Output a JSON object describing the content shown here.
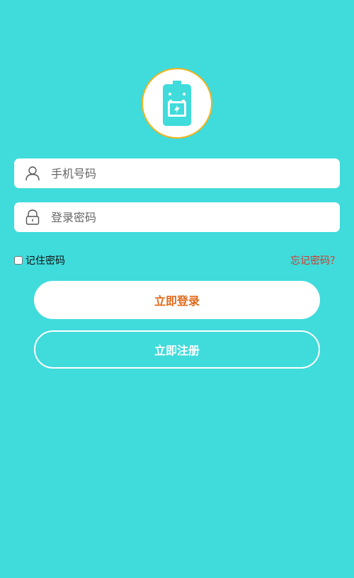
{
  "form": {
    "phone_placeholder": "手机号码",
    "password_placeholder": "登录密码"
  },
  "options": {
    "remember_label": "记住密码",
    "forgot_label": "忘记密码？"
  },
  "buttons": {
    "login_label": "立即登录",
    "register_label": "立即注册"
  },
  "icons": {
    "logo": "battery-icon",
    "phone": "user-icon",
    "password": "lock-icon"
  },
  "colors": {
    "background": "#40DBDB",
    "logo_border": "#F2B31C",
    "login_text": "#E06A1A",
    "forgot_text": "#D03A28"
  }
}
